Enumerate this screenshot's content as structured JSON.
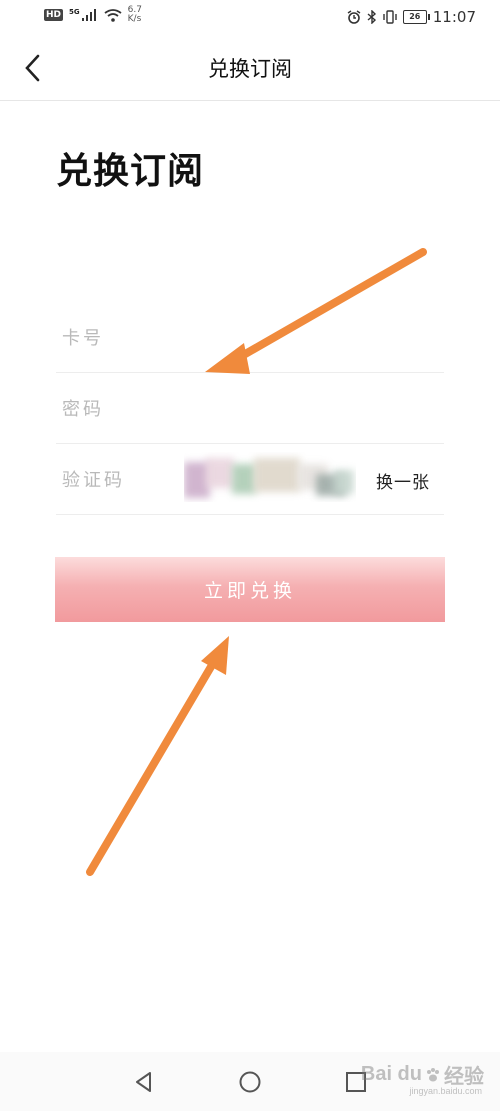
{
  "status_bar": {
    "hd": "HD",
    "signal": "5G",
    "net_speed_value": "6.7",
    "net_speed_unit": "K/s",
    "battery": "26",
    "time": "11:07"
  },
  "nav": {
    "title": "兑换订阅"
  },
  "page": {
    "heading": "兑换订阅"
  },
  "form": {
    "card_number_label": "卡号",
    "password_label": "密码",
    "captcha_label": "验证码",
    "captcha_refresh": "换一张",
    "submit_label": "立即兑换"
  },
  "colors": {
    "accent": "#f19a9d",
    "arrow": "#f08a3c"
  },
  "watermark": {
    "brand": "Bai du",
    "brand_cn": "经验",
    "url": "jingyan.baidu.com"
  }
}
